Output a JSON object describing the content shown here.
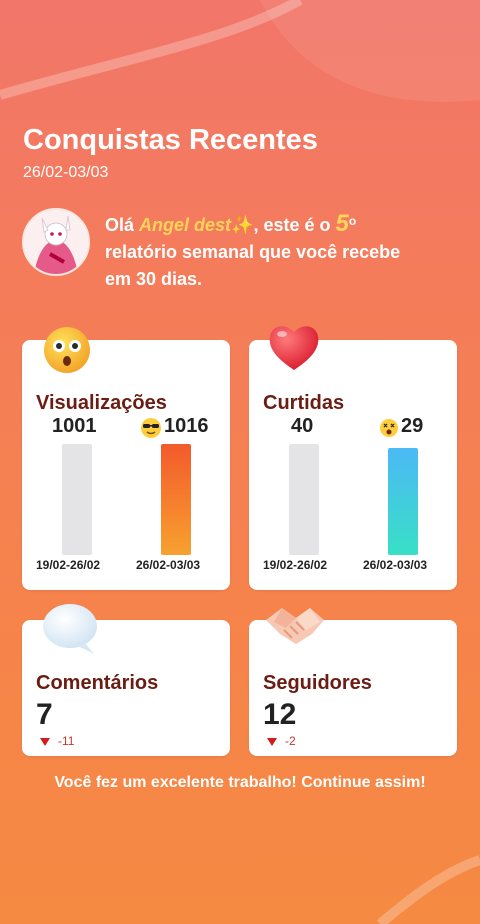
{
  "header": {
    "title": "Conquistas Recentes",
    "date_range": "26/02-03/03"
  },
  "greeting": {
    "prefix": "Olá ",
    "user_name": "Angel dest",
    "middle": ", este é o ",
    "report_number": "5",
    "ordinal": "o",
    "line2": "relatório semanal que você recebe",
    "line3": "em 30 dias."
  },
  "views": {
    "label": "Visualizações",
    "prev_value": "1001",
    "curr_value": "1016",
    "prev_period": "19/02-26/02",
    "curr_period": "26/02-03/03",
    "icon": "surprised-face-icon"
  },
  "likes": {
    "label": "Curtidas",
    "prev_value": "40",
    "curr_value": "29",
    "prev_period": "19/02-26/02",
    "curr_period": "26/02-03/03",
    "icon": "heart-icon"
  },
  "comments": {
    "label": "Comentários",
    "value": "7",
    "delta": "-11",
    "icon": "speech-bubble-icon"
  },
  "followers": {
    "label": "Seguidores",
    "value": "12",
    "delta": "-2",
    "icon": "handshake-icon"
  },
  "footer": {
    "message": "Você fez um excelente trabalho! Continue assim!"
  },
  "colors": {
    "accent_orange": "#f35a2c",
    "accent_blue": "#4cb9f6",
    "label_brown": "#6b1d14",
    "name_yellow": "#ffd35a"
  }
}
